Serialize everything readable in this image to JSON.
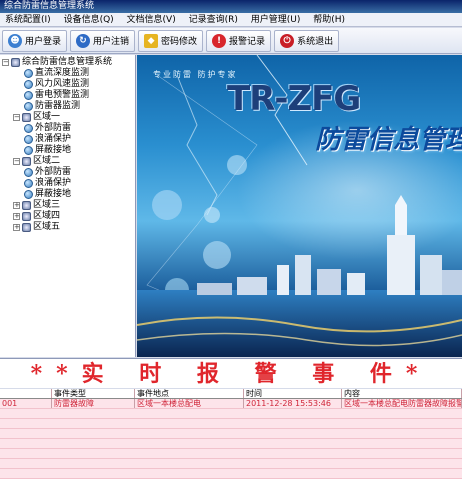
{
  "window": {
    "title": "综合防雷信息管理系统"
  },
  "menu": [
    "系统配置(I)",
    "设备信息(Q)",
    "文档信息(V)",
    "记录查询(R)",
    "用户管理(U)",
    "帮助(H)"
  ],
  "toolbar": {
    "login": "用户登录",
    "logout": "用户注销",
    "password": "密码修改",
    "alarm_log": "报警记录",
    "exit": "系统退出"
  },
  "tree": {
    "root": "综合防雷信息管理系统",
    "items": [
      "直流深度监测",
      "风力风速监测",
      "雷电预警监测",
      "防雷器监测"
    ],
    "zone1": {
      "label": "区域一",
      "children": [
        "外部防雷",
        "浪涌保护",
        "屏蔽接地"
      ]
    },
    "zone2": {
      "label": "区域二",
      "children": [
        "外部防雷",
        "浪涌保护",
        "屏蔽接地"
      ]
    },
    "zone3": "区域三",
    "zone4": "区域四",
    "zone5": "区域五"
  },
  "banner": {
    "tagline": "专业防雷  防护专家",
    "brand": "TR-ZFG",
    "product": "防雷信息管理"
  },
  "alarm": {
    "heading": "**实 时 报 警 事 件*",
    "columns": [
      "",
      "事件类型",
      "事件地点",
      "时间",
      "内容"
    ],
    "rows": [
      [
        "001",
        "防雷器故障",
        "区域一本楼总配电",
        "2011-12-28 15:53:46",
        "区域一本楼总配电防雷器故障报警"
      ]
    ]
  },
  "colors": {
    "alarm_text": "#e0262c",
    "grid_bg": "#fde4ea",
    "title_bar": "#0a246a"
  }
}
